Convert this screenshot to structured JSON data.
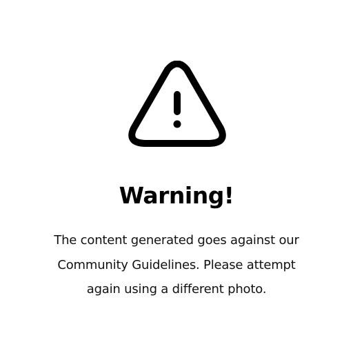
{
  "dialog": {
    "icon": "warning-triangle-icon",
    "title": "Warning!",
    "message_lines": [
      "The content generated goes against our",
      "Community Guidelines. Please attempt",
      "again using a different photo."
    ]
  },
  "colors": {
    "background": "#ffffff",
    "foreground": "#000000"
  }
}
